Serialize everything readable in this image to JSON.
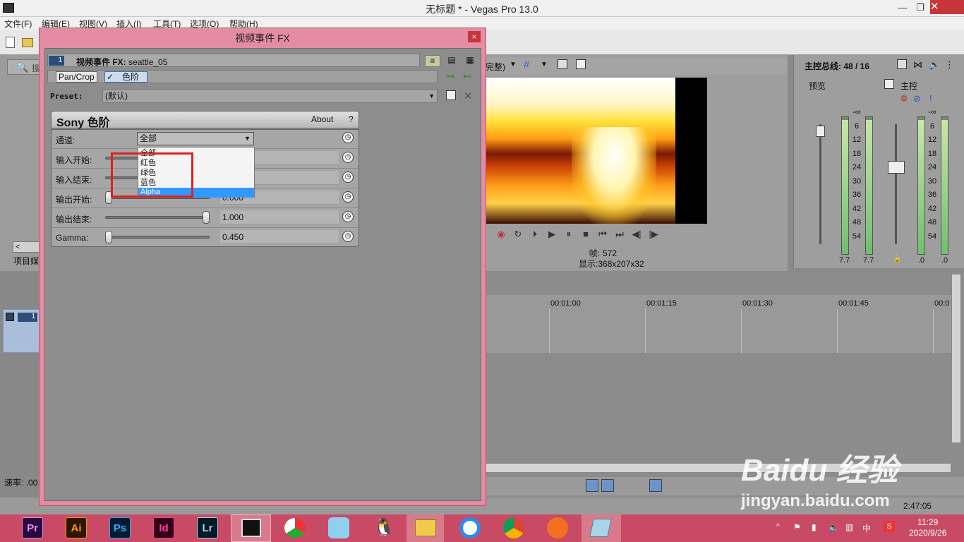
{
  "window": {
    "title": "无标题 * - Vegas Pro 13.0",
    "controls": [
      "—",
      "❐",
      "✕"
    ]
  },
  "menu": [
    "文件(F)",
    "编辑(E)",
    "视图(V)",
    "插入(I)",
    "工具(T)",
    "选项(O)",
    "帮助(H)"
  ],
  "left_pane": {
    "search_placeholder": "搜",
    "tab_label": "项目媒"
  },
  "fx_dialog": {
    "title": "视频事件 FX",
    "close": "×",
    "chain_index": "1",
    "chain_label_prefix": "视频事件 FX:",
    "chain_label_value": "seattle_05",
    "chain_items": [
      "Pan/Crop",
      "色阶"
    ],
    "preset_label": "Preset:",
    "preset_value": "(默认)",
    "plugin": {
      "name": "Sony 色阶",
      "about": "About",
      "help": "?",
      "channel_label": "通道:",
      "channel_value": "全部",
      "channel_options": [
        "全部",
        "红色",
        "绿色",
        "蓝色",
        "Alpha"
      ],
      "channel_selected_option": "Alpha",
      "rows": [
        {
          "label": "输入开始:",
          "value": ""
        },
        {
          "label": "输入结束:",
          "value": ""
        },
        {
          "label": "输出开始:",
          "value": "0.000"
        },
        {
          "label": "输出结束:",
          "value": "1.000"
        },
        {
          "label": "Gamma:",
          "value": "0.450"
        }
      ],
      "slider_levels": {
        "output_start": 0.0,
        "output_end": 1.0,
        "gamma": 0.0
      }
    }
  },
  "preview": {
    "quality_label": "完整)",
    "frame_label": "帧:",
    "frame_value": "572",
    "display_label": "显示:",
    "display_value": "368x207x32"
  },
  "master": {
    "bus_label": "主控总线: 48 / 16",
    "preview_label": "预览",
    "master_label": "主控",
    "scale": [
      "-∞",
      "6",
      "12",
      "18",
      "24",
      "30",
      "36",
      "42",
      "48",
      "54"
    ],
    "preview_peaks": [
      "7.7",
      "7.7"
    ],
    "master_peaks": [
      ".0",
      ".0"
    ]
  },
  "timeline": {
    "ruler": [
      "00:01:00",
      "00:01:15",
      "00:01:30",
      "00:01:45",
      "00:0"
    ],
    "rate_label": "速率: .00",
    "status_time": "2:47:05"
  },
  "taskbar": {
    "apps": [
      "Pr",
      "Ai",
      "Ps",
      "Id",
      "Lr"
    ],
    "clock_time": "11:29",
    "clock_date": "2020/9/26"
  },
  "watermark": {
    "brand": "Baidu 经验",
    "url": "jingyan.baidu.com"
  },
  "colors": {
    "taskbar": "#c94a64",
    "dialog_frame": "#e38ca4",
    "highlight": "#e02020",
    "selection": "#3399ff"
  }
}
